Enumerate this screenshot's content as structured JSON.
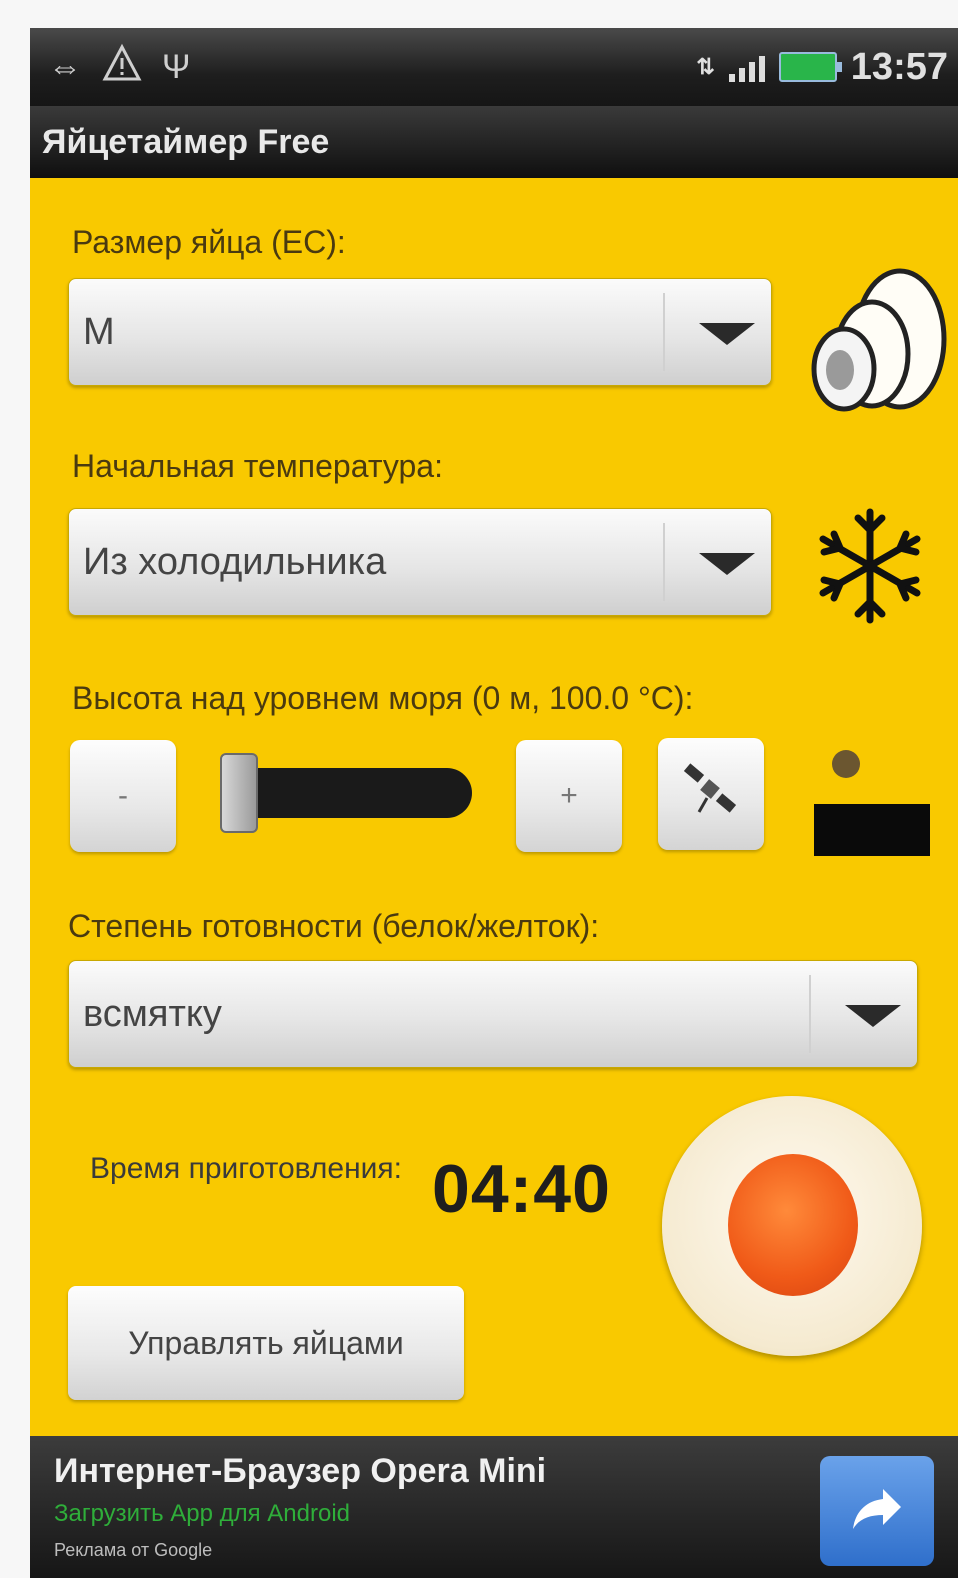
{
  "status_bar": {
    "time": "13:57",
    "icons": [
      "usb-debug-icon",
      "warning-icon",
      "usb-icon",
      "network-icon",
      "signal-icon",
      "battery-icon"
    ]
  },
  "app": {
    "title": "Яйцетаймер Free"
  },
  "egg_size": {
    "label": "Размер яйца (ЕС):",
    "value": "M",
    "icon": "egg-size-icon"
  },
  "start_temp": {
    "label": "Начальная температура:",
    "value": "Из холодильника",
    "icon": "snowflake-icon"
  },
  "altitude": {
    "label": "Высота над уровнем моря (0 м, 100.0 °C):",
    "minus_label": "-",
    "plus_label": "+",
    "slider_level": 0,
    "icons": [
      "satellite-icon",
      "altitude-icon"
    ]
  },
  "doneness": {
    "label": "Степень готовности (белок/желток):",
    "value": "всмятку"
  },
  "cook_time": {
    "label": "Время приготовления:",
    "value": "04:40"
  },
  "manage_button": {
    "label": "Управлять яйцами"
  },
  "ad": {
    "title": "Интернет-Браузер Opera Mini",
    "subtitle": "Загрузить App для Android",
    "source": "Реклама от Google"
  },
  "colors": {
    "background": "#f9c900",
    "bar": "#1e1e1e",
    "ad_accent": "#2fae3a",
    "share_button": "#3a7bd5"
  }
}
